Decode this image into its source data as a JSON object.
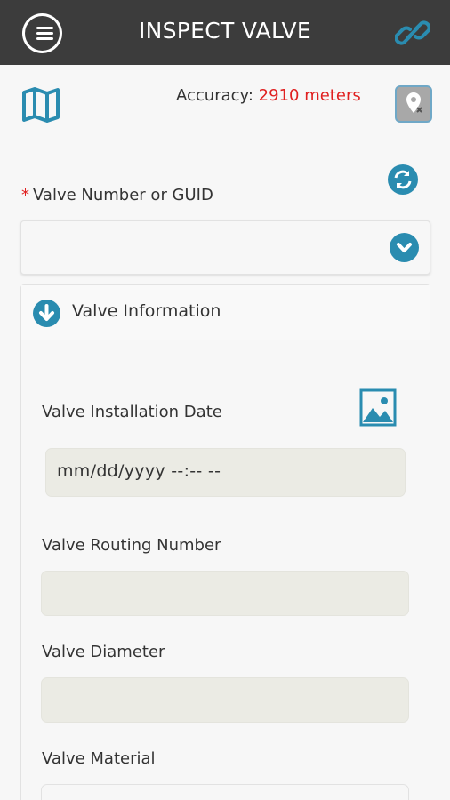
{
  "header": {
    "title": "INSPECT VALVE"
  },
  "location": {
    "accuracy_label": "Accuracy:",
    "accuracy_value": "2910 meters"
  },
  "valve_select": {
    "required_mark": "*",
    "label": "Valve Number or GUID",
    "value": ""
  },
  "section": {
    "title": "Valve Information",
    "fields": {
      "installation_date": {
        "label": "Valve Installation Date",
        "placeholder": "mm/dd/yyyy --:-- --"
      },
      "routing_number": {
        "label": "Valve Routing Number",
        "value": ""
      },
      "diameter": {
        "label": "Valve Diameter",
        "value": ""
      },
      "material": {
        "label": "Valve Material",
        "value": ""
      }
    }
  },
  "colors": {
    "header_bg": "#3c3c3c",
    "accent": "#2a8cb0",
    "error": "#e02020",
    "input_bg": "#ebebe4"
  },
  "icons": [
    "menu-icon",
    "link-icon",
    "map-icon",
    "location-pin-icon",
    "refresh-icon",
    "chevron-down-icon",
    "arrow-down-icon",
    "image-icon"
  ]
}
